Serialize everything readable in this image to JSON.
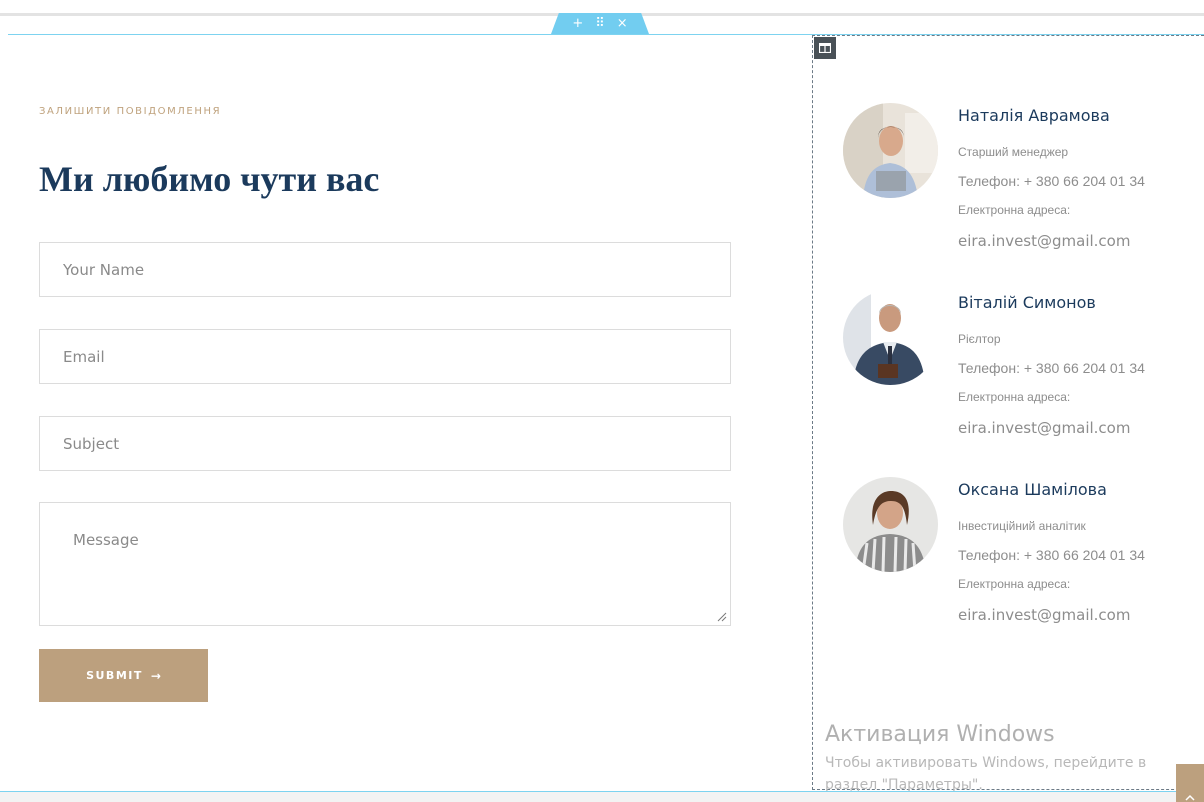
{
  "editor": {
    "section_add": "+",
    "section_move": "⠿",
    "section_close": "×"
  },
  "form": {
    "eyebrow": "ЗАЛИШИТИ ПОВІДОМЛЕННЯ",
    "heading": "Ми любимо чути вас",
    "name_placeholder": "Your Name",
    "email_placeholder": "Email",
    "subject_placeholder": "Subject",
    "message_placeholder": "Message",
    "submit_label": "SUBMIT",
    "submit_arrow": "→"
  },
  "contacts": [
    {
      "name": "Наталія Аврамова",
      "role": "Старший менеджер",
      "phone": "Телефон: + 380 66 204 01 34",
      "email_label": "Електронна адреса:",
      "email": "eira.invest@gmail.com"
    },
    {
      "name": "Віталій Симонов",
      "role": "Рієлтор",
      "phone": "Телефон: + 380 66 204 01 34",
      "email_label": "Електронна адреса:",
      "email": "eira.invest@gmail.com"
    },
    {
      "name": "Оксана Шамілова",
      "role": "Інвестиційний аналітик",
      "phone": "Телефон: + 380 66 204 01 34",
      "email_label": "Електронна адреса:",
      "email": "eira.invest@gmail.com"
    }
  ],
  "watermark": {
    "title": "Активация Windows",
    "line1": "Чтобы активировать Windows, перейдите в",
    "line2": "раздел \"Параметры\"."
  },
  "colors": {
    "accent": "#bca07e",
    "heading": "#1b3a5c",
    "editor_blue": "#72cdf0"
  }
}
